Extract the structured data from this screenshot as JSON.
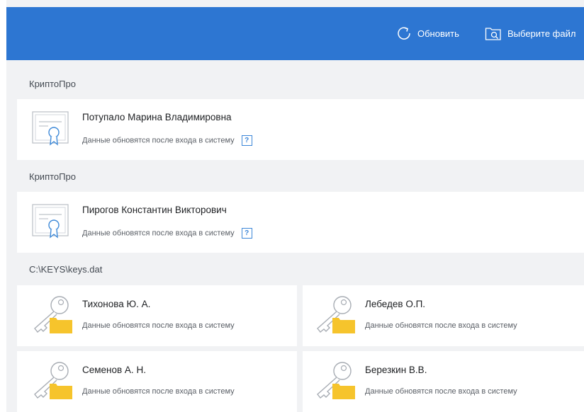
{
  "header": {
    "refresh_label": "Обновить",
    "select_file_label": "Выберите файл"
  },
  "groups": [
    {
      "label": "КриптоПро",
      "items": [
        {
          "name": "Потупало Марина Владимировна",
          "status": "Данные обновятся после входа в систему",
          "help": "?"
        }
      ]
    },
    {
      "label": "КриптоПро",
      "items": [
        {
          "name": "Пирогов Константин Викторович",
          "status": "Данные обновятся после входа в систему",
          "help": "?"
        }
      ]
    },
    {
      "label": "C:\\KEYS\\keys.dat",
      "items": [
        {
          "name": "Тихонова Ю. А.",
          "status": "Данные обновятся после входа в систему"
        },
        {
          "name": "Лебедев О.П.",
          "status": "Данные обновятся после входа в систему"
        },
        {
          "name": "Семенов А. Н.",
          "status": "Данные обновятся после входа в систему"
        },
        {
          "name": "Березкин В.В.",
          "status": "Данные обновятся после входа в систему"
        }
      ]
    }
  ],
  "icons": {
    "certificate": "certificate-icon",
    "key": "key-folder-icon",
    "refresh": "refresh-icon",
    "file_search": "file-search-icon"
  },
  "colors": {
    "header": "#2d76d2",
    "background": "#f1f2f4",
    "card": "#ffffff",
    "folder": "#f6c42c",
    "help": "#3b86d8"
  }
}
